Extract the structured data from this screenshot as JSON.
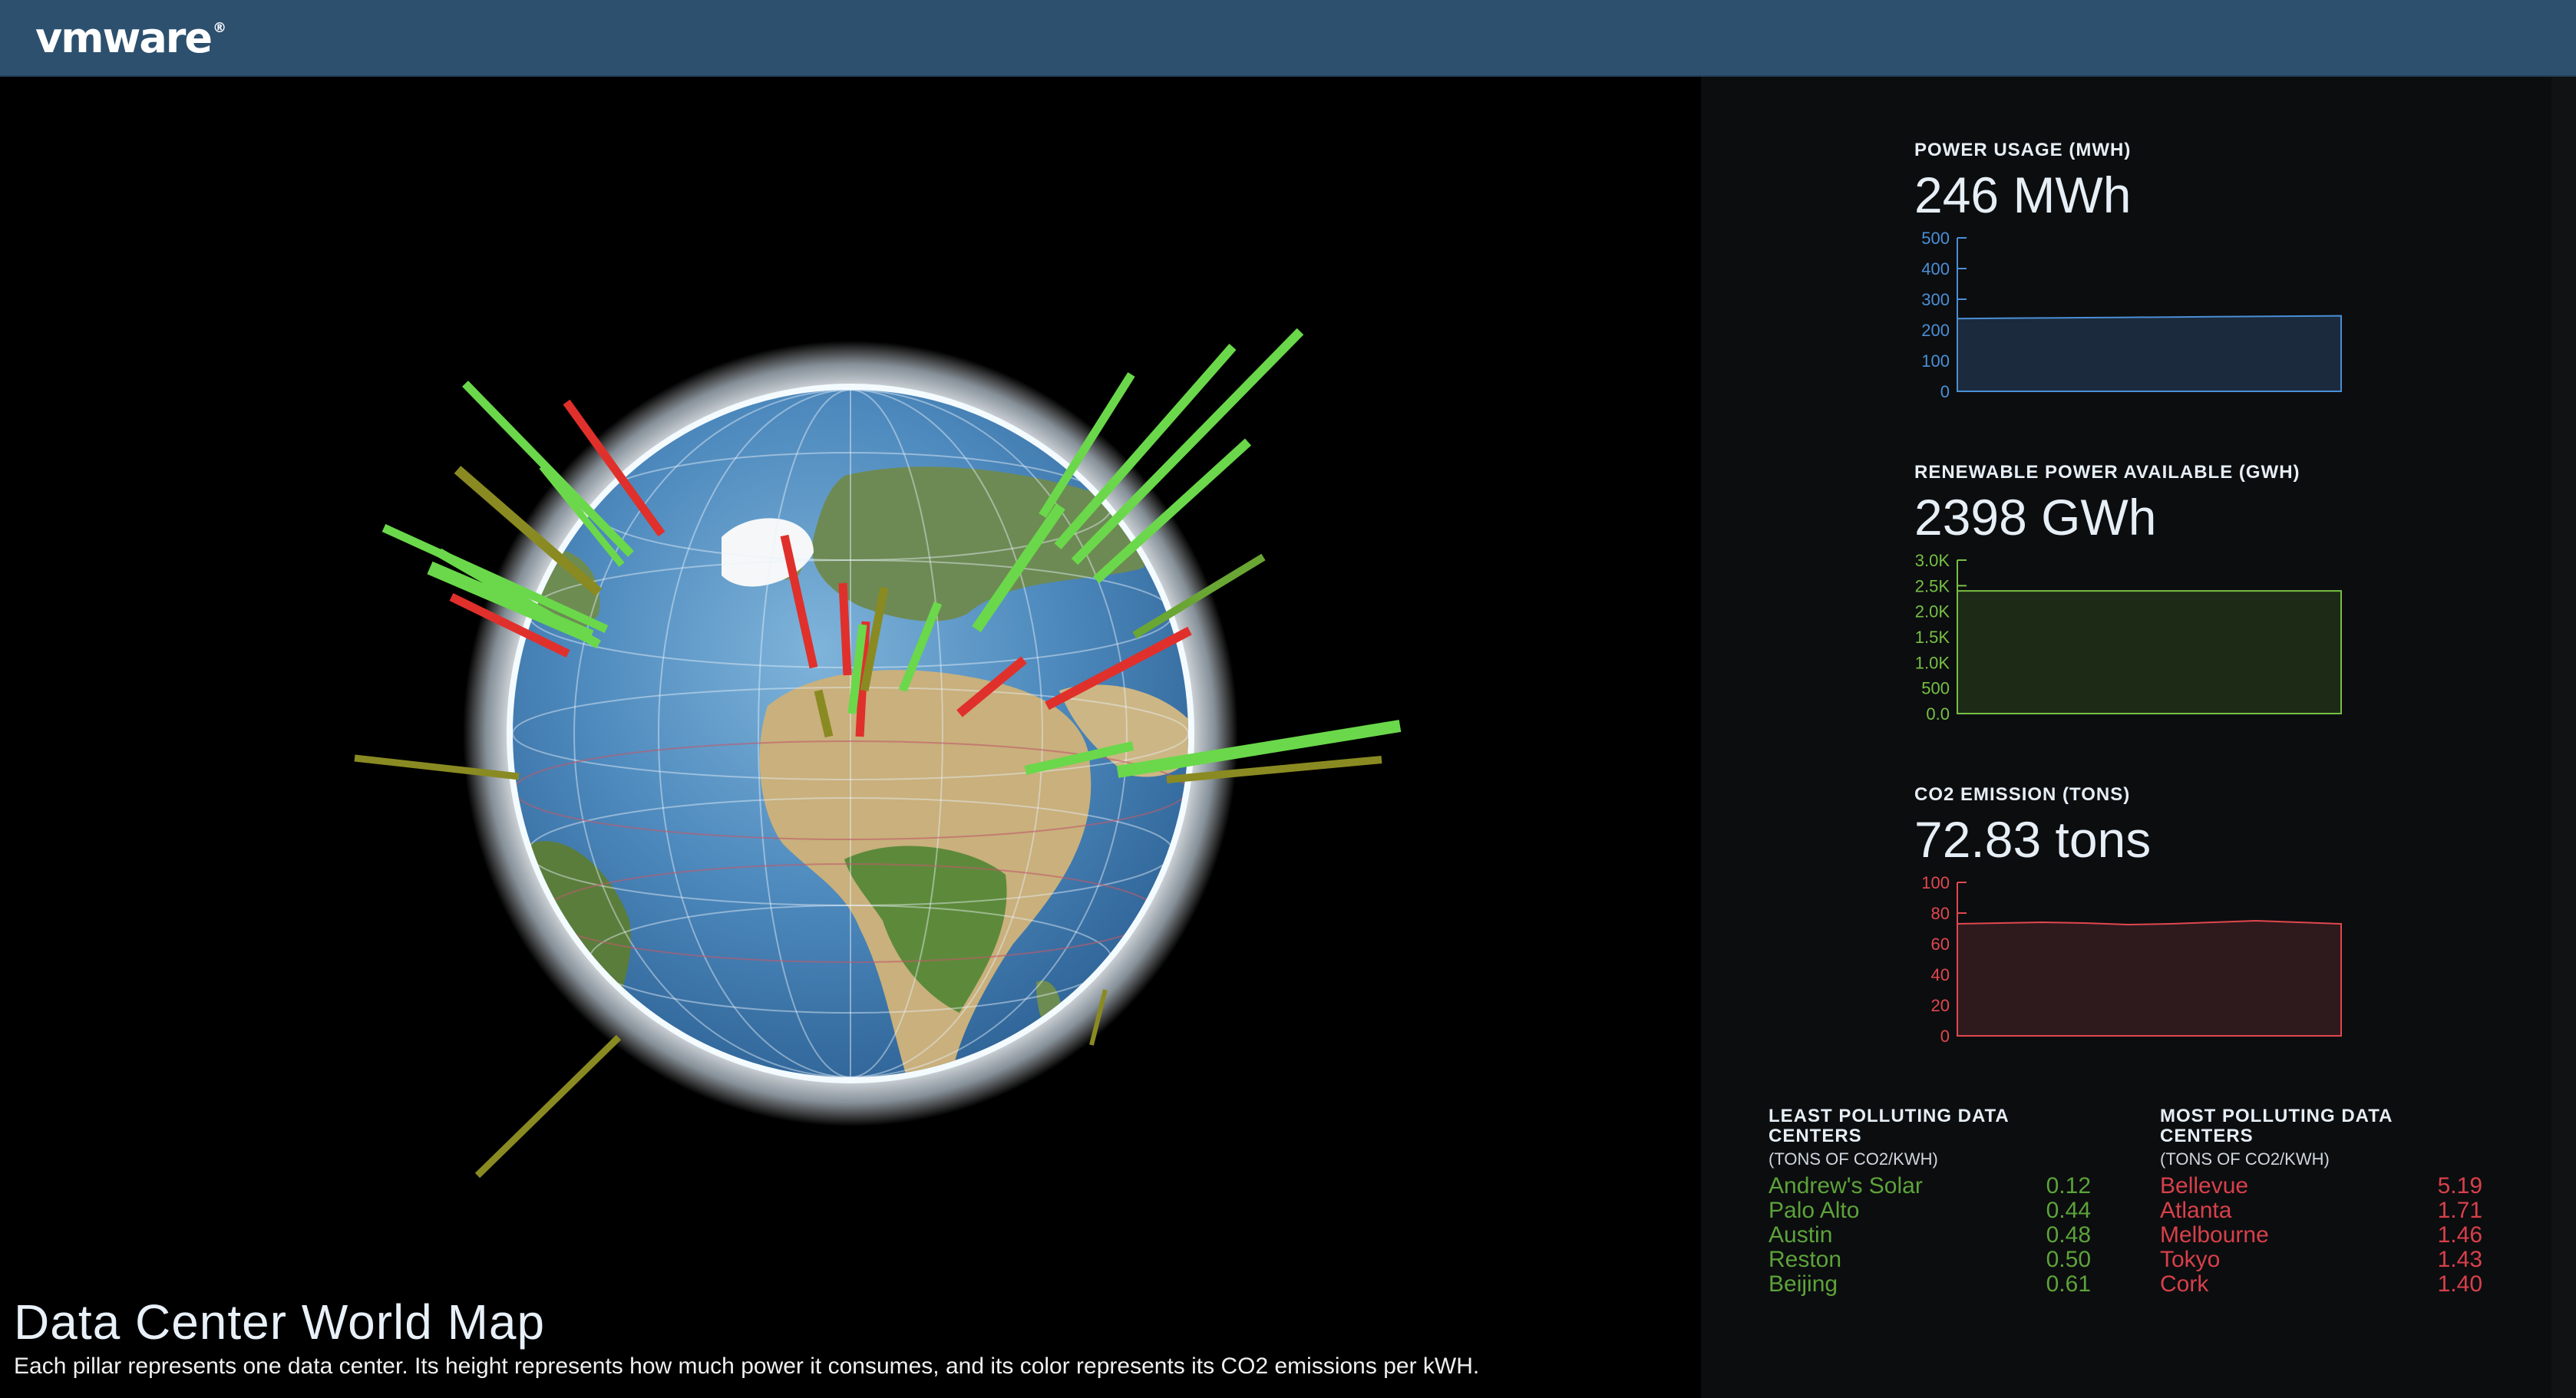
{
  "header": {
    "logo": "vmware",
    "logo_mark": "®"
  },
  "main": {
    "title": "Data Center World Map",
    "subtitle": "Each pillar represents one data center. Its height represents how much power it consumes, and its color represents its CO2 emissions per kWH."
  },
  "colors": {
    "header_bg": "#2d506e",
    "power": "#4a8fd6",
    "renewable": "#76c043",
    "co2": "#e0484e"
  },
  "metrics": [
    {
      "label": "POWER USAGE (MWH)",
      "value": "246 MWh",
      "color": "#4a8fd6",
      "fill": "#1b2a3c",
      "ticks": [
        "500",
        "400",
        "300",
        "200",
        "100",
        "0"
      ],
      "range": [
        0,
        500
      ],
      "series": [
        237,
        238,
        239,
        240,
        241,
        242,
        243,
        244,
        245,
        246
      ]
    },
    {
      "label": "RENEWABLE POWER AVAILABLE (GWH)",
      "value": "2398 GWh",
      "color": "#76c043",
      "fill": "#1d2a16",
      "ticks": [
        "3.0K",
        "2.5K",
        "2.0K",
        "1.5K",
        "1.0K",
        "500",
        "0.0"
      ],
      "range": [
        0,
        3000
      ],
      "series": [
        2398,
        2398,
        2398,
        2398,
        2398,
        2398,
        2398,
        2398,
        2398,
        2398
      ]
    },
    {
      "label": "CO2 EMISSION (TONS)",
      "value": "72.83 tons",
      "color": "#e0484e",
      "fill": "#2e1a1d",
      "ticks": [
        "100",
        "80",
        "60",
        "40",
        "20",
        "0"
      ],
      "range": [
        0,
        100
      ],
      "series": [
        73,
        73.5,
        74,
        73.5,
        72.5,
        73,
        74,
        75,
        74,
        73
      ]
    }
  ],
  "least": {
    "title": "LEAST POLLUTING DATA CENTERS",
    "unit": "(TONS OF CO2/KWH)",
    "color": "#5ca33a",
    "rows": [
      {
        "name": "Andrew's Solar",
        "value": "0.12"
      },
      {
        "name": "Palo Alto",
        "value": "0.44"
      },
      {
        "name": "Austin",
        "value": "0.48"
      },
      {
        "name": "Reston",
        "value": "0.50"
      },
      {
        "name": "Beijing",
        "value": "0.61"
      }
    ]
  },
  "most": {
    "title": "MOST POLLUTING DATA CENTERS",
    "unit": "(TONS OF CO2/KWH)",
    "color": "#d8404a",
    "rows": [
      {
        "name": "Bellevue",
        "value": "5.19"
      },
      {
        "name": "Atlanta",
        "value": "1.71"
      },
      {
        "name": "Melbourne",
        "value": "1.46"
      },
      {
        "name": "Tokyo",
        "value": "1.43"
      },
      {
        "name": "Cork",
        "value": "1.40"
      }
    ]
  }
}
